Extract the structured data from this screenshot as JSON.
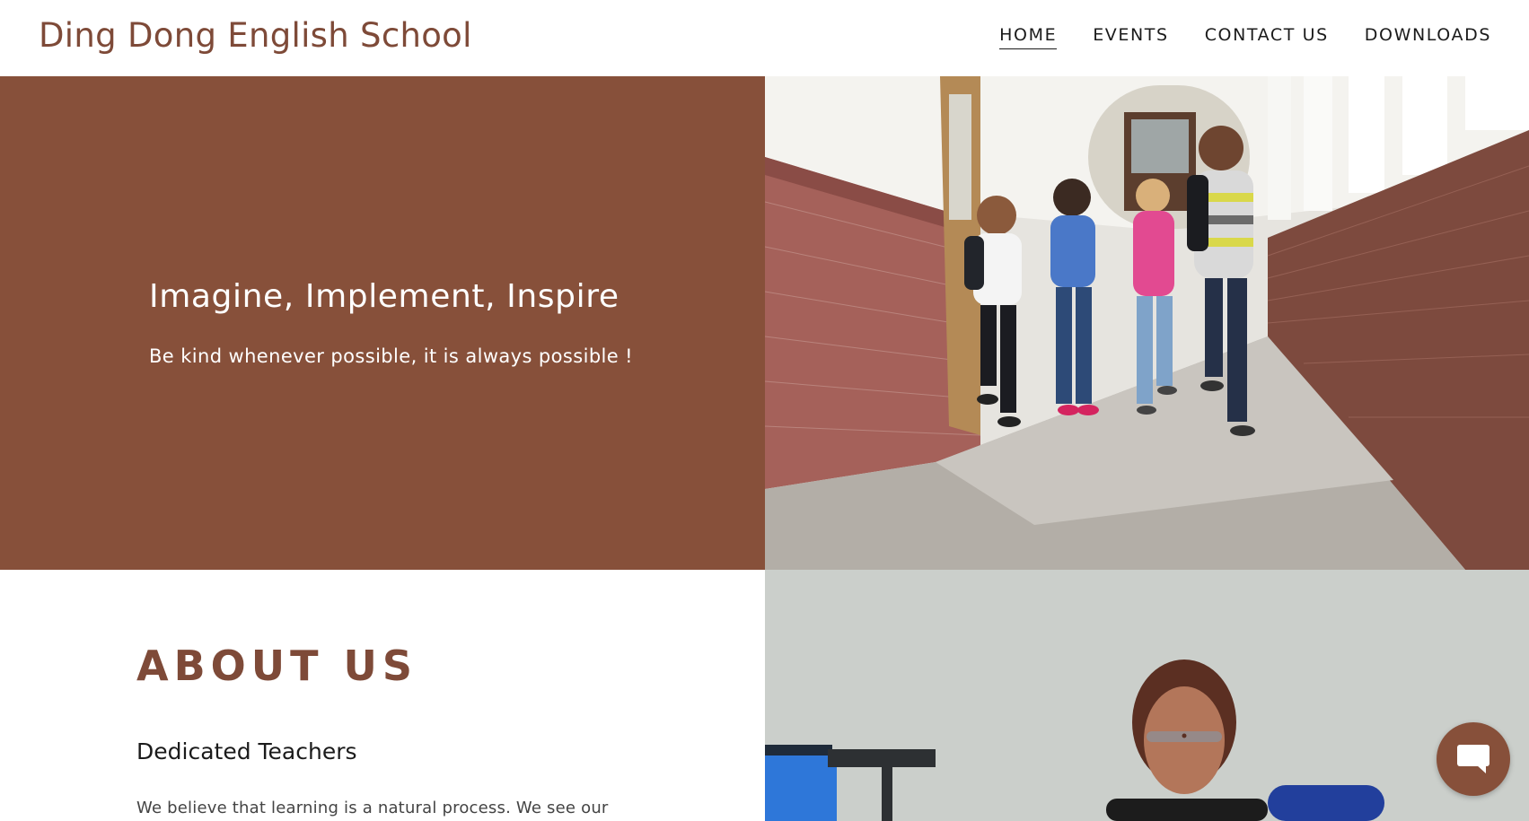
{
  "header": {
    "logo": "Ding Dong English School",
    "nav": [
      {
        "label": "HOME",
        "active": true
      },
      {
        "label": "EVENTS",
        "active": false
      },
      {
        "label": "CONTACT US",
        "active": false
      },
      {
        "label": "DOWNLOADS",
        "active": false
      }
    ]
  },
  "hero": {
    "title": "Imagine, Implement, Inspire",
    "subtitle": "Be kind whenever possible, it is always possible !",
    "background_color": "#87503a",
    "image_icon": "children-running-photo"
  },
  "about": {
    "title": "ABOUT US",
    "subtitle": "Dedicated Teachers",
    "text": "We believe that learning is a natural process. We see our",
    "image_icon": "teacher-photo"
  },
  "chat": {
    "icon": "chat-bubble-icon",
    "color": "#87503a"
  },
  "colors": {
    "brand": "#7e4a38",
    "hero_bg": "#87503a"
  }
}
